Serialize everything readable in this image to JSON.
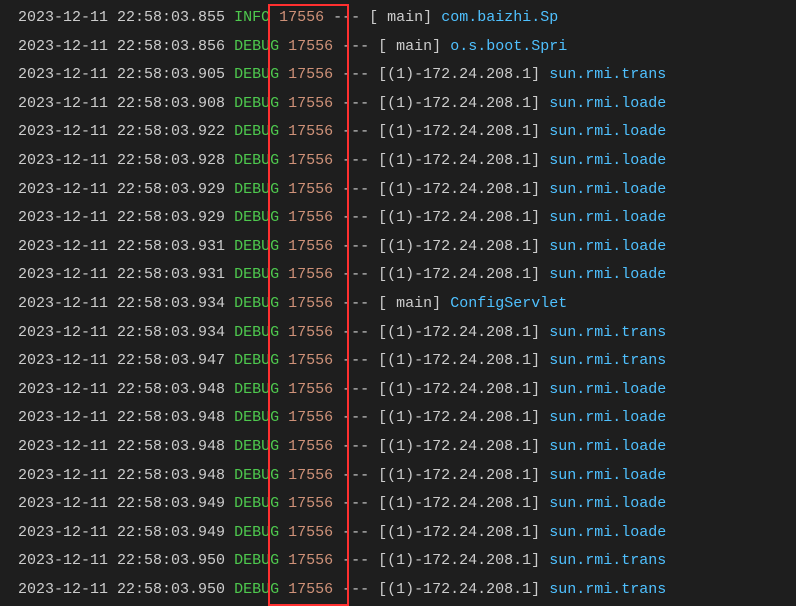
{
  "logs": [
    {
      "ts": "2023-12-11 22:58:03.855",
      "level": " INFO",
      "pid": "17556",
      "sep": "---",
      "thread": "[           main]",
      "logger": "com.baizhi.Sp"
    },
    {
      "ts": "2023-12-11 22:58:03.856",
      "level": "DEBUG",
      "pid": "17556",
      "sep": "---",
      "thread": "[           main]",
      "logger": "o.s.boot.Spri"
    },
    {
      "ts": "2023-12-11 22:58:03.905",
      "level": "DEBUG",
      "pid": "17556",
      "sep": "---",
      "thread": "[(1)-172.24.208.1]",
      "logger": "sun.rmi.trans"
    },
    {
      "ts": "2023-12-11 22:58:03.908",
      "level": "DEBUG",
      "pid": "17556",
      "sep": "---",
      "thread": "[(1)-172.24.208.1]",
      "logger": "sun.rmi.loade"
    },
    {
      "ts": "2023-12-11 22:58:03.922",
      "level": "DEBUG",
      "pid": "17556",
      "sep": "---",
      "thread": "[(1)-172.24.208.1]",
      "logger": "sun.rmi.loade"
    },
    {
      "ts": "2023-12-11 22:58:03.928",
      "level": "DEBUG",
      "pid": "17556",
      "sep": "---",
      "thread": "[(1)-172.24.208.1]",
      "logger": "sun.rmi.loade"
    },
    {
      "ts": "2023-12-11 22:58:03.929",
      "level": "DEBUG",
      "pid": "17556",
      "sep": "---",
      "thread": "[(1)-172.24.208.1]",
      "logger": "sun.rmi.loade"
    },
    {
      "ts": "2023-12-11 22:58:03.929",
      "level": "DEBUG",
      "pid": "17556",
      "sep": "---",
      "thread": "[(1)-172.24.208.1]",
      "logger": "sun.rmi.loade"
    },
    {
      "ts": "2023-12-11 22:58:03.931",
      "level": "DEBUG",
      "pid": "17556",
      "sep": "---",
      "thread": "[(1)-172.24.208.1]",
      "logger": "sun.rmi.loade"
    },
    {
      "ts": "2023-12-11 22:58:03.931",
      "level": "DEBUG",
      "pid": "17556",
      "sep": "---",
      "thread": "[(1)-172.24.208.1]",
      "logger": "sun.rmi.loade"
    },
    {
      "ts": "2023-12-11 22:58:03.934",
      "level": "DEBUG",
      "pid": "17556",
      "sep": "---",
      "thread": "[           main]",
      "logger": "ConfigServlet"
    },
    {
      "ts": "2023-12-11 22:58:03.934",
      "level": "DEBUG",
      "pid": "17556",
      "sep": "---",
      "thread": "[(1)-172.24.208.1]",
      "logger": "sun.rmi.trans"
    },
    {
      "ts": "2023-12-11 22:58:03.947",
      "level": "DEBUG",
      "pid": "17556",
      "sep": "---",
      "thread": "[(1)-172.24.208.1]",
      "logger": "sun.rmi.trans"
    },
    {
      "ts": "2023-12-11 22:58:03.948",
      "level": "DEBUG",
      "pid": "17556",
      "sep": "---",
      "thread": "[(1)-172.24.208.1]",
      "logger": "sun.rmi.loade"
    },
    {
      "ts": "2023-12-11 22:58:03.948",
      "level": "DEBUG",
      "pid": "17556",
      "sep": "---",
      "thread": "[(1)-172.24.208.1]",
      "logger": "sun.rmi.loade"
    },
    {
      "ts": "2023-12-11 22:58:03.948",
      "level": "DEBUG",
      "pid": "17556",
      "sep": "---",
      "thread": "[(1)-172.24.208.1]",
      "logger": "sun.rmi.loade"
    },
    {
      "ts": "2023-12-11 22:58:03.948",
      "level": "DEBUG",
      "pid": "17556",
      "sep": "---",
      "thread": "[(1)-172.24.208.1]",
      "logger": "sun.rmi.loade"
    },
    {
      "ts": "2023-12-11 22:58:03.949",
      "level": "DEBUG",
      "pid": "17556",
      "sep": "---",
      "thread": "[(1)-172.24.208.1]",
      "logger": "sun.rmi.loade"
    },
    {
      "ts": "2023-12-11 22:58:03.949",
      "level": "DEBUG",
      "pid": "17556",
      "sep": "---",
      "thread": "[(1)-172.24.208.1]",
      "logger": "sun.rmi.loade"
    },
    {
      "ts": "2023-12-11 22:58:03.950",
      "level": "DEBUG",
      "pid": "17556",
      "sep": "---",
      "thread": "[(1)-172.24.208.1]",
      "logger": "sun.rmi.trans"
    },
    {
      "ts": "2023-12-11 22:58:03.950",
      "level": "DEBUG",
      "pid": "17556",
      "sep": "---",
      "thread": "[(1)-172.24.208.1]",
      "logger": "sun.rmi.trans"
    }
  ]
}
